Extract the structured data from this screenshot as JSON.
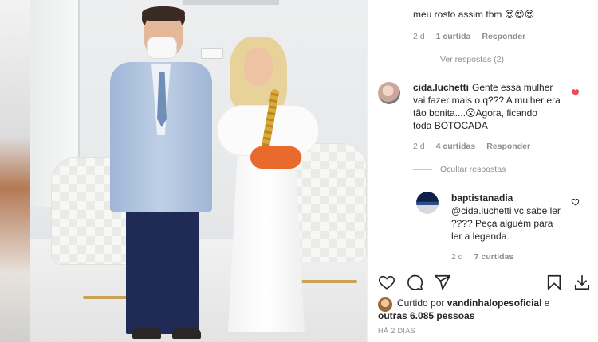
{
  "comments": {
    "prev_comment": {
      "text": "meu rosto assim tbm 😍😍😍",
      "age": "2 d",
      "likes": "1 curtida",
      "reply": "Responder"
    },
    "view_replies": "Ver respostas (2)",
    "cida": {
      "username": "cida.luchetti",
      "line1": "Gente essa mulher",
      "line2": "vai fazer mais o q??? A mulher era",
      "line3": "tão bonita....😮Agora, ficando",
      "line4": "toda BOTOCADA",
      "age": "2 d",
      "likes": "4 curtidas",
      "reply": "Responder",
      "liked": true
    },
    "hide_replies": "Ocultar respostas",
    "baptista": {
      "username": "baptistanadia",
      "line1": "@cida.luchetti vc sabe ler",
      "line2": "???? Peça alguém para",
      "line3": "ler a legenda.",
      "age": "2 d",
      "likes": "7 curtidas"
    }
  },
  "actions": {
    "icons": [
      "heart-icon",
      "comment-icon",
      "share-icon",
      "bookmark-icon",
      "download-icon"
    ]
  },
  "likes_summary": {
    "prefix": "Curtido por",
    "user": "vandinhalopesoficial",
    "mid": "e",
    "others": "outras 6.085 pessoas"
  },
  "post_date": "HÁ 2 DIAS",
  "colors": {
    "liked_heart": "#ed4956",
    "meta_gray": "#8e8e8e",
    "text": "#262626"
  }
}
